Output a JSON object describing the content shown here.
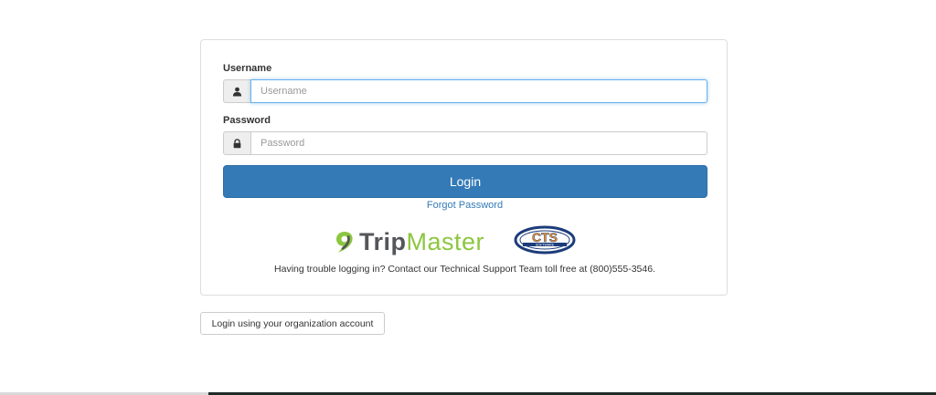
{
  "login_form": {
    "username_label": "Username",
    "username_placeholder": "Username",
    "username_value": "",
    "password_label": "Password",
    "password_placeholder": "Password",
    "password_value": "",
    "login_button": "Login",
    "forgot_password": "Forgot Password",
    "help_text": "Having trouble logging in? Contact our Technical Support Team toll free at (800)555-3546."
  },
  "logos": {
    "tripmaster_part1": "Trip",
    "tripmaster_part2": "Master",
    "cts_text": "CTS",
    "cts_subtext": "SOFTWARE"
  },
  "org_login_button": "Login using your organization account",
  "colors": {
    "primary": "#337ab7",
    "tripmaster_green": "#8cc63f",
    "tripmaster_gray": "#55565a",
    "cts_orange": "#f7941d",
    "cts_navy": "#1c3c7a"
  },
  "icons": {
    "username_addon": "user-icon",
    "password_addon": "lock-icon"
  }
}
